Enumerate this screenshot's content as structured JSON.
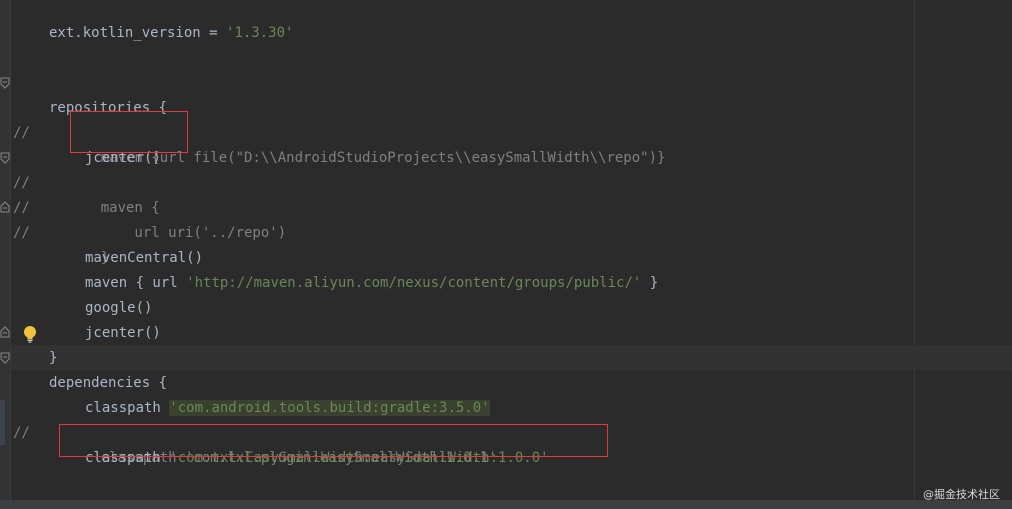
{
  "comment_marker": "//",
  "lines": {
    "l1": {
      "prefix": "ext.kotlin_version = ",
      "string": "'1.3.30'"
    },
    "l2": {
      "text": "repositories {"
    },
    "l3": {
      "text": "    maven {url file(\"D:\\\\AndroidStudioProjects\\\\easySmallWidth\\\\repo\")}"
    },
    "l4": {
      "text": "jcenter()"
    },
    "l5": {
      "text": "    maven {"
    },
    "l6": {
      "text": "        url uri('../repo')"
    },
    "l7": {
      "text": "    }"
    },
    "l8": {
      "text": "mavenCentral()"
    },
    "l9": {
      "prefix": "maven { url ",
      "string": "'http://maven.aliyun.com/nexus/content/groups/public/'",
      "suffix": " }"
    },
    "l10": {
      "text": "google()"
    },
    "l11": {
      "text": "jcenter()"
    },
    "l12": {
      "text": "}"
    },
    "l13": {
      "text": "dependencies {"
    },
    "l14": {
      "prefix": "classpath ",
      "string": "'com.android.tools.build:gradle:3.5.0'"
    },
    "l15": {
      "text": "    classpath 'com.txl.plugin:easySmallWidth:1.0.1'"
    },
    "l16": {
      "prefix": "classpath ",
      "string": "'com.txl.EasySmallWidth:easySmallWidth:1.0.0'"
    }
  },
  "watermark": "@掘金技术社区",
  "colors": {
    "background": "#2b2b2b",
    "text": "#a9b7c6",
    "string": "#6a8759",
    "comment": "#808080",
    "annotation_box": "#e03a3a"
  },
  "icons": {
    "fold": "fold-marker-icon",
    "bulb": "lightbulb-icon"
  }
}
